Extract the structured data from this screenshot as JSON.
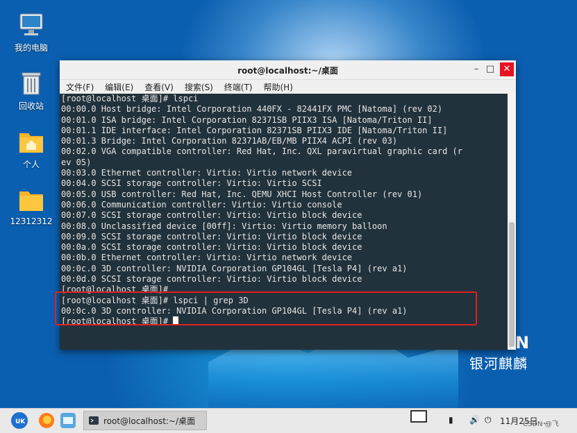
{
  "desktop": {
    "icons": [
      {
        "label": "我的电脑"
      },
      {
        "label": "回收站"
      },
      {
        "label": "个人"
      },
      {
        "label": "12312312"
      }
    ],
    "brand": "银河麒麟",
    "brand_letter": "N"
  },
  "window": {
    "title": "root@localhost:~/桌面",
    "controls": {
      "minimize": "–",
      "maximize": "□",
      "close": "✕"
    },
    "menu": [
      "文件(F)",
      "编辑(E)",
      "查看(V)",
      "搜索(S)",
      "终端(T)",
      "帮助(H)"
    ]
  },
  "terminal": {
    "lines": [
      "[root@localhost 桌面]# lspci",
      "00:00.0 Host bridge: Intel Corporation 440FX - 82441FX PMC [Natoma] (rev 02)",
      "00:01.0 ISA bridge: Intel Corporation 82371SB PIIX3 ISA [Natoma/Triton II]",
      "00:01.1 IDE interface: Intel Corporation 82371SB PIIX3 IDE [Natoma/Triton II]",
      "00:01.3 Bridge: Intel Corporation 82371AB/EB/MB PIIX4 ACPI (rev 03)",
      "00:02.0 VGA compatible controller: Red Hat, Inc. QXL paravirtual graphic card (r",
      "ev 05)",
      "00:03.0 Ethernet controller: Virtio: Virtio network device",
      "00:04.0 SCSI storage controller: Virtio: Virtio SCSI",
      "00:05.0 USB controller: Red Hat, Inc. QEMU XHCI Host Controller (rev 01)",
      "00:06.0 Communication controller: Virtio: Virtio console",
      "00:07.0 SCSI storage controller: Virtio: Virtio block device",
      "00:08.0 Unclassified device [00ff]: Virtio: Virtio memory balloon",
      "00:09.0 SCSI storage controller: Virtio: Virtio block device",
      "00:0a.0 SCSI storage controller: Virtio: Virtio block device",
      "00:0b.0 Ethernet controller: Virtio: Virtio network device",
      "00:0c.0 3D controller: NVIDIA Corporation GP104GL [Tesla P4] (rev a1)",
      "00:0d.0 SCSI storage controller: Virtio: Virtio block device",
      "[root@localhost 桌面]#",
      "[root@localhost 桌面]# lspci | grep 3D",
      "00:0c.0 3D controller: NVIDIA Corporation GP104GL [Tesla P4] (rev a1)"
    ],
    "prompt": "[root@localhost 桌面]# "
  },
  "taskbar": {
    "task_label": "root@localhost:~/桌面",
    "clock": "11月25日 ...",
    "watermark": "CSDN @飞"
  },
  "colors": {
    "terminal_bg": "#22323c",
    "terminal_fg": "#e6e6e6",
    "highlight": "#e02020"
  }
}
